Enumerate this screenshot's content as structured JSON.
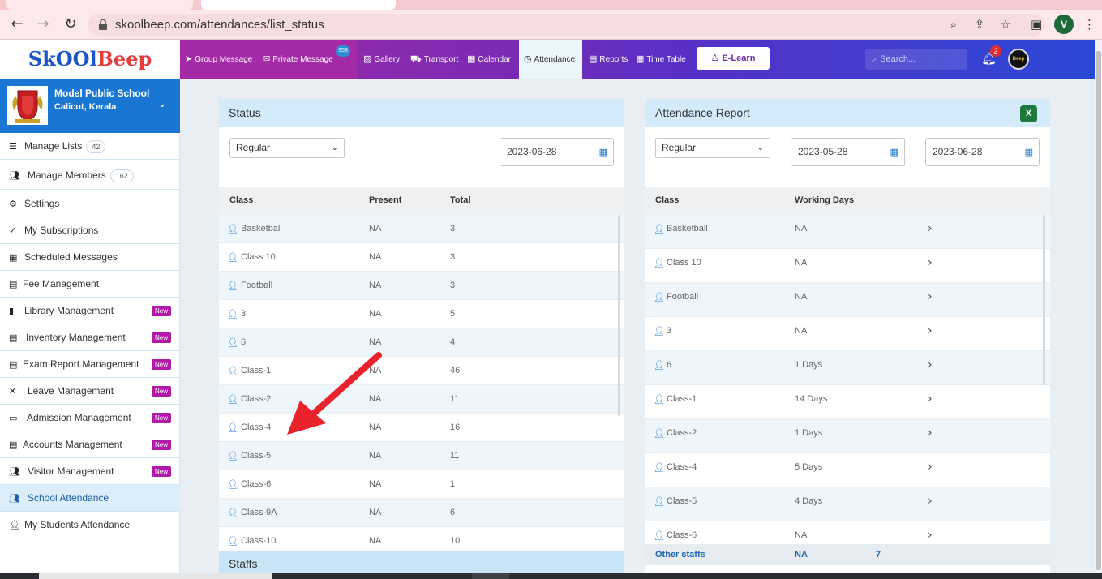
{
  "browser": {
    "url": "skoolbeep.com/attendances/list_status",
    "profile_initial": "V"
  },
  "app": {
    "logo_part1": "SkOOl",
    "logo_part2": "Beep",
    "nav": [
      {
        "label": "Group Message",
        "icon": "paper-plane-icon"
      },
      {
        "label": "Private Message",
        "icon": "envelope-icon",
        "badge": "358"
      },
      {
        "label": "Gallery",
        "icon": "image-icon"
      },
      {
        "label": "Transport",
        "icon": "bus-icon"
      },
      {
        "label": "Calendar",
        "icon": "calendar-icon"
      },
      {
        "label": "Attendance",
        "icon": "clock-icon"
      },
      {
        "label": "Reports",
        "icon": "file-icon"
      },
      {
        "label": "Time Table",
        "icon": "calendar-icon"
      }
    ],
    "elearn_label": "E-Learn",
    "search_placeholder": "Search...",
    "notification_count": "2",
    "avatar_text": "Beep"
  },
  "sidebar": {
    "school_name": "Model Public School",
    "school_location": "Calicut, Kerala",
    "items": [
      {
        "label": "Manage Lists",
        "count": "42",
        "icon": "list-icon"
      },
      {
        "label": "Manage Members",
        "count": "162",
        "icon": "users-icon"
      },
      {
        "label": "Settings",
        "icon": "gear-icon"
      },
      {
        "label": "My Subscriptions",
        "icon": "check-icon"
      },
      {
        "label": "Scheduled Messages",
        "icon": "calendar-icon"
      },
      {
        "label": "Fee Management",
        "icon": "file-icon"
      },
      {
        "label": "Library Management",
        "icon": "book-icon",
        "new": "New"
      },
      {
        "label": "Inventory Management",
        "icon": "list-alt-icon",
        "new": "New"
      },
      {
        "label": "Exam Report Management",
        "icon": "file-icon",
        "new": "New"
      },
      {
        "label": "Leave Management",
        "icon": "user-slash-icon",
        "new": "New"
      },
      {
        "label": "Admission Management",
        "icon": "id-card-icon",
        "new": "New"
      },
      {
        "label": "Accounts Management",
        "icon": "file-invoice-icon",
        "new": "New"
      },
      {
        "label": "Visitor Management",
        "icon": "users-icon",
        "new": "New"
      },
      {
        "label": "School Attendance",
        "icon": "users-icon",
        "active": true
      },
      {
        "label": "My Students Attendance",
        "icon": "user-icon"
      }
    ]
  },
  "status_card": {
    "title": "Status",
    "type_select": "Regular",
    "date": "2023-06-28",
    "columns": [
      "Class",
      "Present",
      "Total"
    ],
    "rows": [
      [
        "Basketball",
        "NA",
        "3"
      ],
      [
        "Class 10",
        "NA",
        "3"
      ],
      [
        "Football",
        "NA",
        "3"
      ],
      [
        "3",
        "NA",
        "5"
      ],
      [
        "6",
        "NA",
        "4"
      ],
      [
        "Class-1",
        "NA",
        "46"
      ],
      [
        "Class-2",
        "NA",
        "11"
      ],
      [
        "Class-4",
        "NA",
        "16"
      ],
      [
        "Class-5",
        "NA",
        "11"
      ],
      [
        "Class-6",
        "NA",
        "1"
      ],
      [
        "Class-9A",
        "NA",
        "6"
      ],
      [
        "Class-10",
        "NA",
        "10"
      ]
    ]
  },
  "staffs_title": "Staffs",
  "report_card": {
    "title": "Attendance Report",
    "type_select": "Regular",
    "date_from": "2023-05-28",
    "date_to": "2023-06-28",
    "columns": [
      "Class",
      "Working Days"
    ],
    "rows": [
      [
        "Basketball",
        "NA"
      ],
      [
        "Class 10",
        "NA"
      ],
      [
        "Football",
        "NA"
      ],
      [
        "3",
        "NA"
      ],
      [
        "6",
        "1 Days"
      ],
      [
        "Class-1",
        "14 Days"
      ],
      [
        "Class-2",
        "1 Days"
      ],
      [
        "Class-4",
        "5 Days"
      ],
      [
        "Class-5",
        "4 Days"
      ],
      [
        "Class-6",
        "NA"
      ]
    ],
    "footer": {
      "label": "Other staffs",
      "working": "NA",
      "count": "7"
    }
  }
}
